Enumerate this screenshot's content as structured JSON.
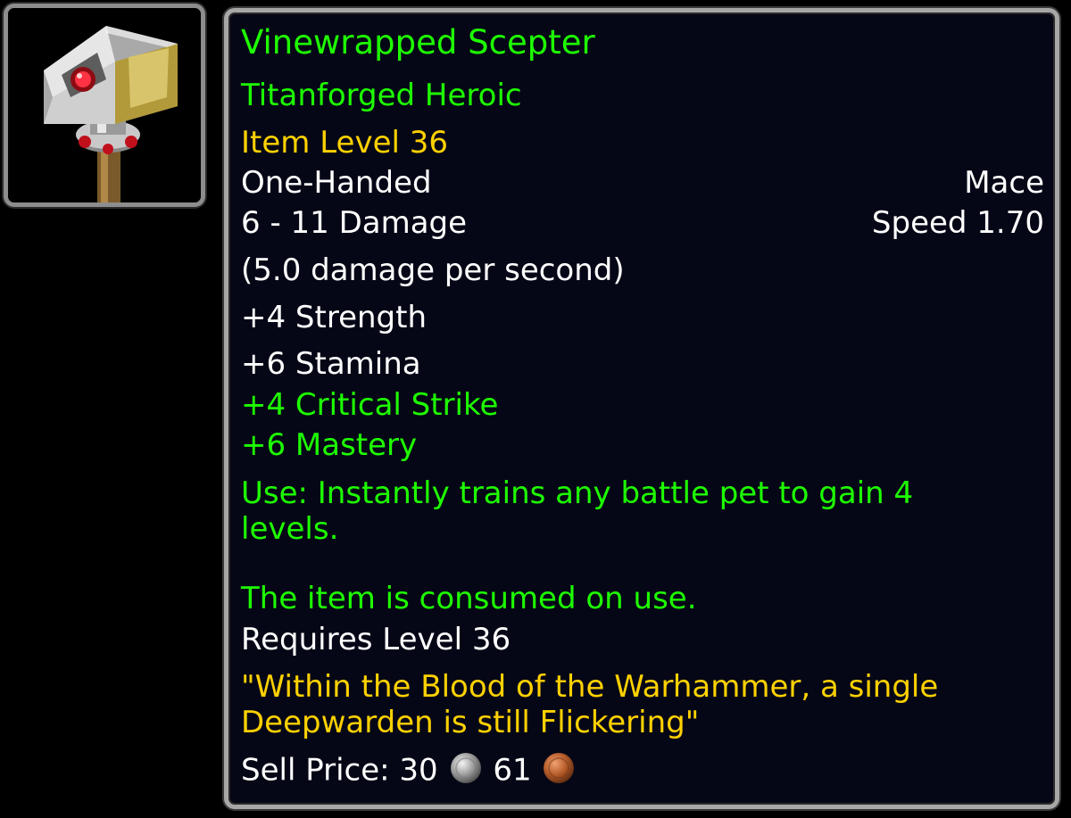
{
  "item": {
    "name": "Vinewrapped Scepter",
    "upgrade": "Titanforged Heroic",
    "item_level": "Item Level 36",
    "slot": "One-Handed",
    "weapon_type": "Mace",
    "damage": "6 - 11 Damage",
    "speed": "Speed 1.70",
    "dps": "(5.0 damage per second)",
    "stats": [
      "+4 Strength",
      "+6 Stamina"
    ],
    "secondary_stats": [
      "+4 Critical Strike",
      "+6 Mastery"
    ],
    "use_effect": "Use: Instantly trains any battle pet to gain 4 levels.",
    "consumed_text": "The item is consumed on use.",
    "requires": "Requires Level 36",
    "flavor": "\"Within the Blood of the Warhammer, a single Deepwarden is still Flickering\"",
    "sell_label": "Sell Price:",
    "sell_silver": "30",
    "sell_copper": "61"
  },
  "icons": {
    "item_icon": "mace-icon",
    "silver": "silver-coin-icon",
    "copper": "copper-coin-icon"
  },
  "colors": {
    "uncommon_green": "#1eff00",
    "item_level_yellow": "#ffd100",
    "text_white": "#ffffff",
    "tooltip_bg": "#050716",
    "border": "#a7a7a7"
  }
}
